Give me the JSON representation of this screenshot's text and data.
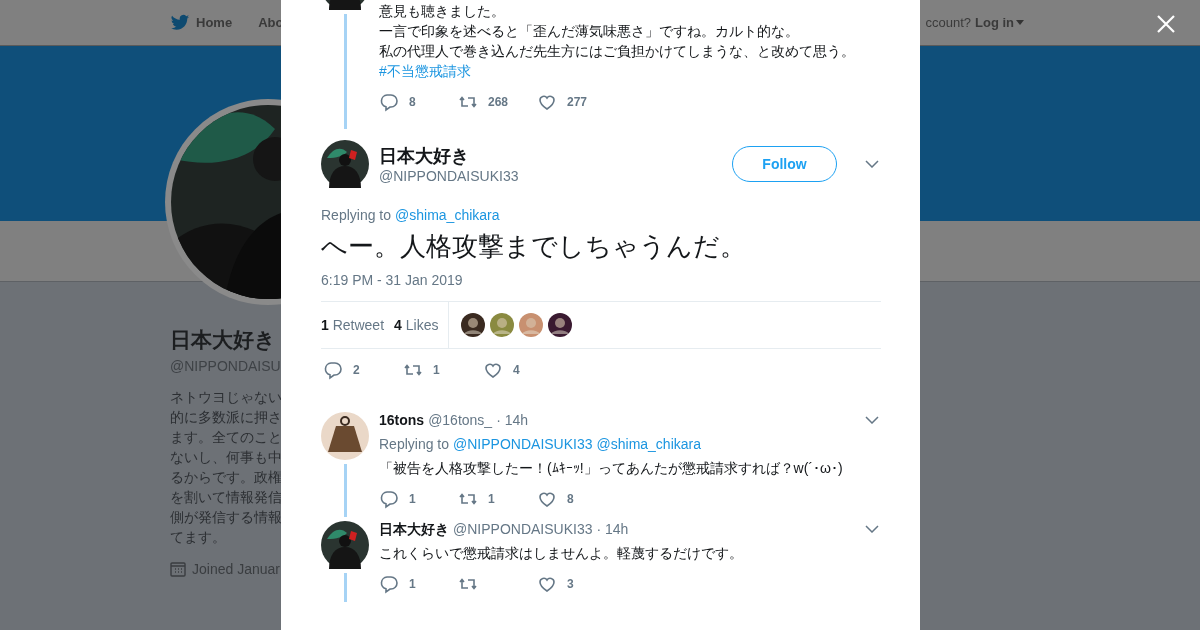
{
  "nav": {
    "items": [
      {
        "label": "Home",
        "kind": "home"
      },
      {
        "label": "Abo",
        "kind": "plain"
      }
    ],
    "login_prompt": "ccount?",
    "login": "Log in"
  },
  "profile": {
    "name": "日本大好き",
    "handle": "@NIPPONDAISU",
    "bio": [
      "ネトウヨじゃない",
      "的に多数派に押さ",
      "ます。全てのこと",
      "ないし、何事も中",
      "るからです。政権",
      "を割いて情報発信",
      "側が発信する情報",
      "てます。"
    ],
    "joined": "Joined Januar"
  },
  "previous_tweet": {
    "lines": [
      "意見も聴きました。",
      "一言で印象を述べると「歪んだ薄気味悪さ」ですね。カルト的な。",
      "私の代理人で巻き込んだ先生方にはご負担かけてしまうな、と改めて思う。"
    ],
    "hashtag": "#不当懲戒請求",
    "replies": "8",
    "retweets": "268",
    "likes": "277"
  },
  "tweet": {
    "name": "日本大好き",
    "handle": "@NIPPONDAISUKI33",
    "follow": "Follow",
    "replying_label": "Replying to",
    "replying_to": [
      "@shima_chikara"
    ],
    "text": "へー。人格攻撃までしちゃうんだ。",
    "timestamp": "6:19 PM - 31 Jan 2019",
    "retweet_count": "1",
    "retweet_label": "Retweet",
    "like_count": "4",
    "like_label": "Likes",
    "likers": [
      {
        "kind": "picture"
      },
      {
        "kind": "picture"
      },
      {
        "kind": "picture"
      },
      {
        "kind": "picture"
      }
    ],
    "replies": "2",
    "retweets": "1",
    "likes": "4"
  },
  "replies": [
    {
      "name": "16tons",
      "handle": "@16tons_",
      "time": "· 14h",
      "replying_label": "Replying to",
      "replying_to": [
        "@NIPPONDAISUKI33",
        "@shima_chikara"
      ],
      "text": "「被告を人格攻撃したー！(ﾑｷｰｯ!」ってあんたが懲戒請求すれば？w(´･ω･)",
      "replies": "1",
      "retweets": "1",
      "likes": "8"
    },
    {
      "name": "日本大好き",
      "handle": "@NIPPONDAISUKI33",
      "time": "· 14h",
      "text": "これくらいで懲戒請求はしませんよ。軽蔑するだけです。",
      "replies": "1",
      "likes": "3"
    }
  ]
}
